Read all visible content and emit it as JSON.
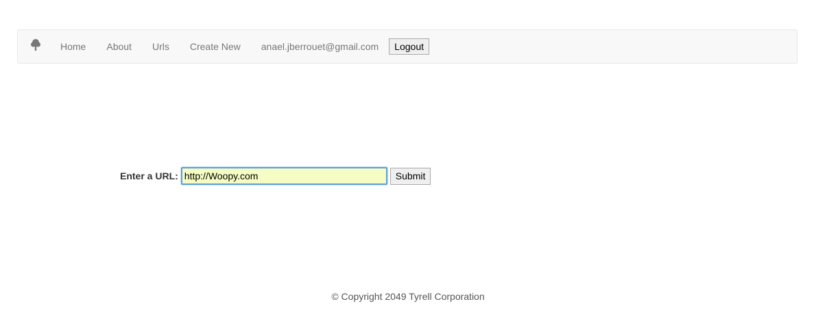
{
  "navbar": {
    "brand_icon": "tree-icon",
    "links": [
      {
        "label": "Home"
      },
      {
        "label": "About"
      },
      {
        "label": "Urls"
      },
      {
        "label": "Create New"
      }
    ],
    "user_email": "anael.jberrouet@gmail.com",
    "logout_label": "Logout"
  },
  "form": {
    "label": "Enter a URL:",
    "url_value": "http://Woopy.com",
    "submit_label": "Submit"
  },
  "footer": {
    "copyright": "© Copyright 2049 Tyrell Corporation"
  },
  "colors": {
    "navbar_bg": "#f8f8f8",
    "input_bg": "#f5fdc4",
    "focus_border": "#5b9dd9"
  }
}
